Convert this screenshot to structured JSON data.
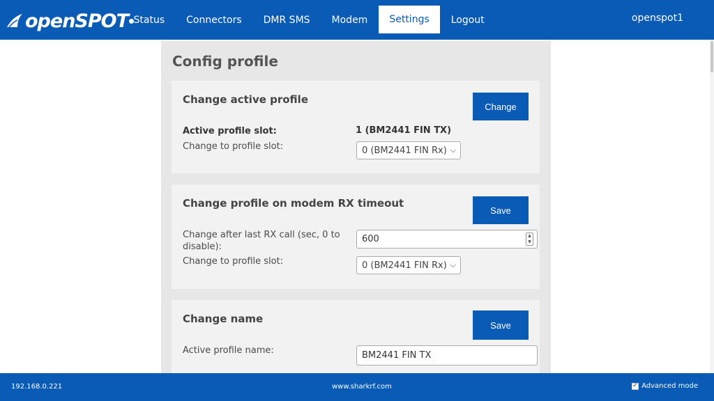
{
  "header": {
    "logo_text": "openSPOT",
    "nav": [
      {
        "label": "Status"
      },
      {
        "label": "Connectors"
      },
      {
        "label": "DMR SMS"
      },
      {
        "label": "Modem"
      },
      {
        "label": "Settings",
        "active": true
      },
      {
        "label": "Logout"
      }
    ],
    "hostname": "openspot1"
  },
  "page": {
    "title": "Config profile"
  },
  "cards": {
    "active_profile": {
      "title": "Change active profile",
      "button": "Change",
      "active_slot_label": "Active profile slot:",
      "active_slot_value": "1 (BM2441 FIN TX)",
      "change_to_label": "Change to profile slot:",
      "change_to_value": "0 (BM2441 FIN Rx)"
    },
    "rx_timeout": {
      "title": "Change profile on modem RX timeout",
      "button": "Save",
      "after_label": "Change after last RX call (sec, 0 to disable):",
      "after_value": "600",
      "change_to_label": "Change to profile slot:",
      "change_to_value": "0 (BM2441 FIN Rx)"
    },
    "name": {
      "title": "Change name",
      "button": "Save",
      "name_label": "Active profile name:",
      "name_value": "BM2441 FIN TX"
    }
  },
  "footer": {
    "ip": "192.168.0.221",
    "site": "www.sharkrf.com",
    "advanced_mode_label": "Advanced mode",
    "advanced_mode_checked": true
  },
  "colors": {
    "brand_blue": "#0a5bb5",
    "panel_bg": "#e7e7e7",
    "card_bg": "#f2f2f2"
  }
}
